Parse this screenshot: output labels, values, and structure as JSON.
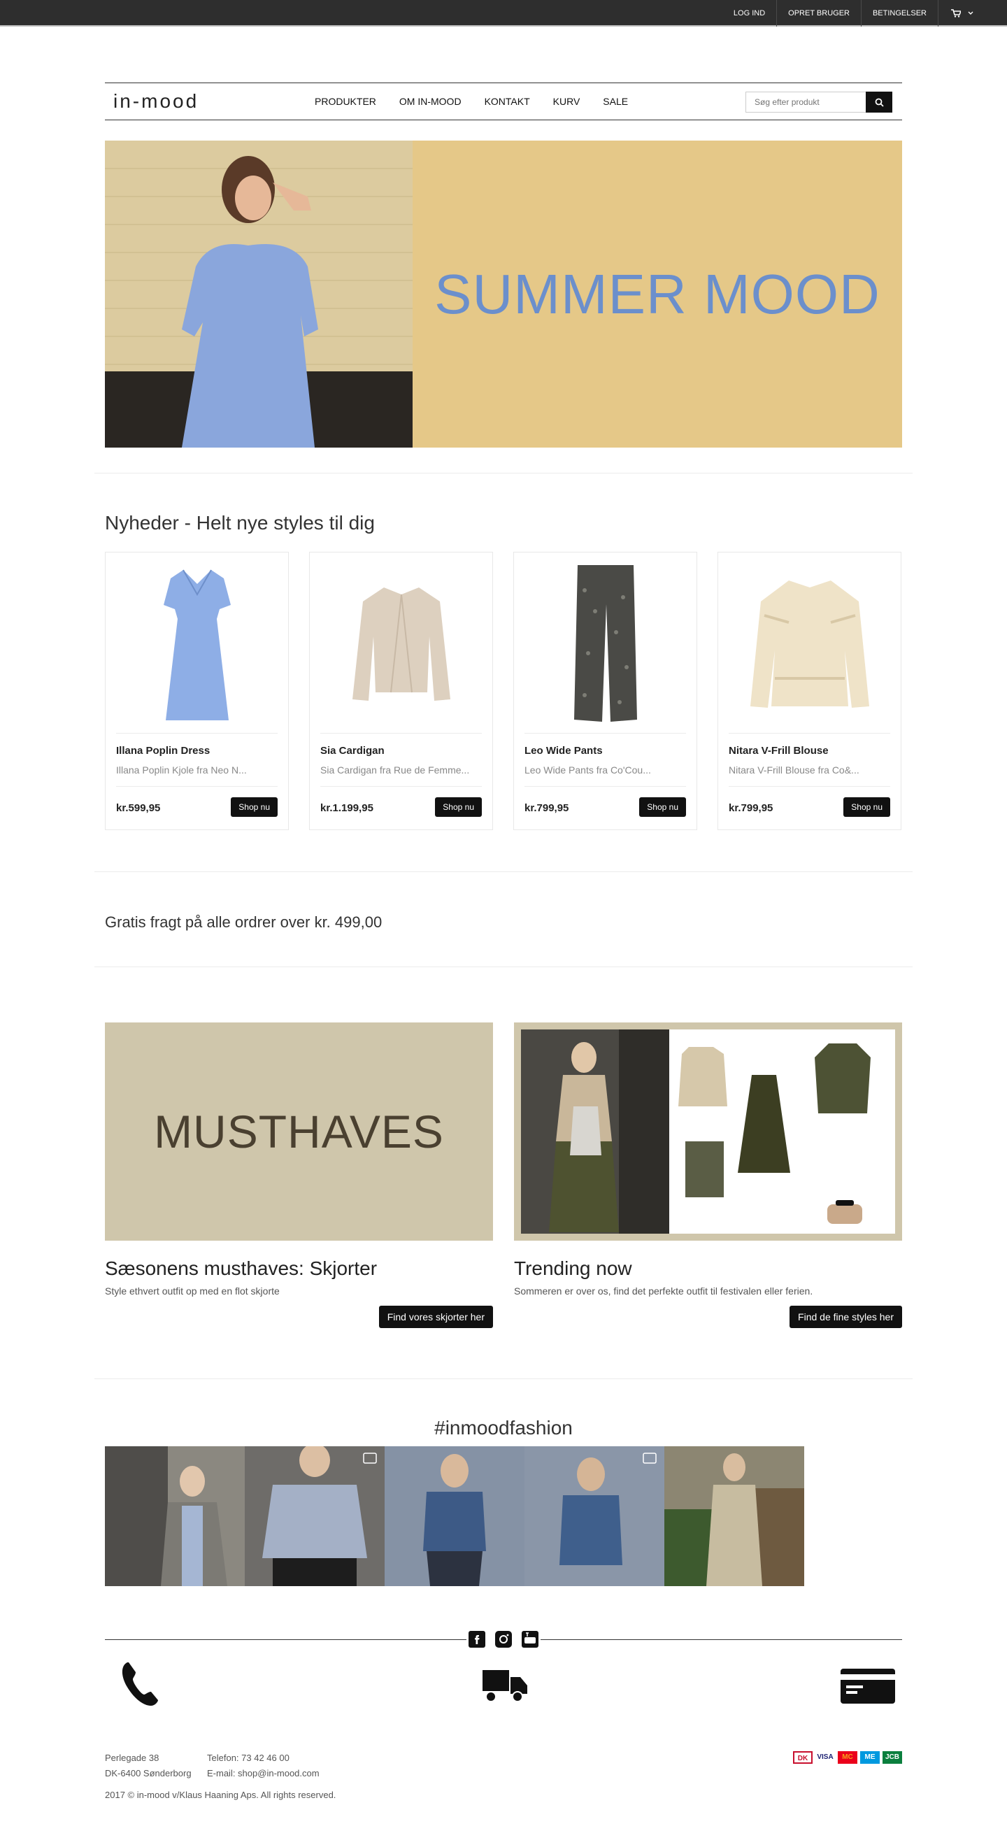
{
  "topbar": {
    "links": [
      "LOG IND",
      "OPRET BRUGER",
      "BETINGELSER"
    ],
    "cart_icon": "cart-icon",
    "caret_icon": "chevron-down-icon"
  },
  "header": {
    "logo": "in-mood",
    "nav": [
      "PRODUKTER",
      "OM IN-MOOD",
      "KONTAKT",
      "KURV",
      "SALE"
    ],
    "search_placeholder": "Søg efter produkt",
    "search_icon": "search-icon"
  },
  "hero": {
    "headline": "SUMMER MOOD",
    "background_color": "#e5c888",
    "headline_color": "#6b8fcc"
  },
  "news": {
    "title": "Nyheder - Helt nye styles til dig",
    "products": [
      {
        "name": "Illana Poplin Dress",
        "desc": "Illana Poplin Kjole fra Neo N...",
        "price": "kr.599,95",
        "button": "Shop nu"
      },
      {
        "name": "Sia Cardigan",
        "desc": "Sia Cardigan fra Rue de Femme...",
        "price": "kr.1.199,95",
        "button": "Shop nu"
      },
      {
        "name": "Leo Wide Pants",
        "desc": "Leo Wide Pants fra Co'Cou...",
        "price": "kr.799,95",
        "button": "Shop nu"
      },
      {
        "name": "Nitara V-Frill Blouse",
        "desc": "Nitara V-Frill Blouse fra Co&...",
        "price": "kr.799,95",
        "button": "Shop nu"
      }
    ]
  },
  "shipping": {
    "text": "Gratis fragt på alle ordrer over kr. 499,00"
  },
  "promos": [
    {
      "image_text": "MUSTHAVES",
      "title": "Sæsonens musthaves: Skjorter",
      "text": "Style ethvert outfit op med en flot skjorte",
      "button": "Find vores skjorter her",
      "bg": "#cfc6ab"
    },
    {
      "title": "Trending now",
      "text": "Sommeren er over os, find det perfekte outfit til festivalen eller ferien.",
      "button": "Find de fine styles her",
      "bg": "#cfc6ab"
    }
  ],
  "instagram": {
    "hashtag": "#inmoodfashion"
  },
  "footer": {
    "social_icons": [
      "facebook-icon",
      "instagram-icon",
      "youtube-icon"
    ],
    "feature_icons": [
      "phone-icon",
      "truck-icon",
      "credit-card-icon"
    ],
    "address_line1": "Perlegade 38",
    "address_line2": "DK-6400 Sønderborg",
    "phone": "Telefon: 73 42 46 00",
    "email": "E-mail: shop@in-mood.com",
    "copyright": "2017 © in-mood v/Klaus Haaning Aps. All rights reserved.",
    "payments": [
      "DK",
      "VISA",
      "MC",
      "ME",
      "JCB"
    ]
  }
}
